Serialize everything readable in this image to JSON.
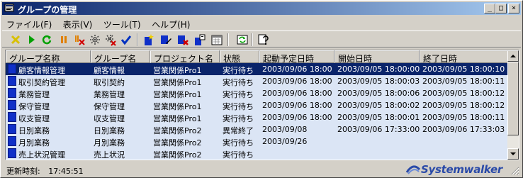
{
  "window": {
    "title": "グループの管理",
    "minimize": "_",
    "maximize": "□",
    "close": "×"
  },
  "menu": [
    {
      "label": "ファイル(F)"
    },
    {
      "label": "表示(V)"
    },
    {
      "label": "ツール(T)"
    },
    {
      "label": "ヘルプ(H)"
    }
  ],
  "toolbar_icons": [
    "cancel-icon",
    "start-icon",
    "restart-icon",
    "pause-icon",
    "stop-icon",
    "disable-icon",
    "enable-icon",
    "confirm-icon",
    "new-group-icon",
    "edit-group-icon",
    "delete-group-icon",
    "properties-icon",
    "calendar-icon",
    "refresh-icon",
    "help-icon"
  ],
  "columns": [
    "グループ名称",
    "グループ名",
    "プロジェクト名",
    "状態",
    "起動予定日時",
    "開始日時",
    "終了日時"
  ],
  "rows": [
    {
      "c0": "顧客情報管理",
      "c1": "顧客情報",
      "c2": "営業関係Pro1",
      "c3": "実行待ち",
      "c4": "2003/09/06 18:00",
      "c5": "2003/09/05 18:00:00",
      "c6": "2003/09/05 18:00:10",
      "selected": true
    },
    {
      "c0": "取引契約管理",
      "c1": "取引契約",
      "c2": "営業関係Pro1",
      "c3": "実行待ち",
      "c4": "2003/09/06 18:00",
      "c5": "2003/09/05 18:00:03",
      "c6": "2003/09/05 18:00:11",
      "selected": false
    },
    {
      "c0": "業務管理",
      "c1": "業務管理",
      "c2": "営業関係Pro1",
      "c3": "実行待ち",
      "c4": "2003/09/06 18:00",
      "c5": "2003/09/05 18:00:06",
      "c6": "2003/09/05 18:00:12",
      "selected": false
    },
    {
      "c0": "保守管理",
      "c1": "保守管理",
      "c2": "営業関係Pro1",
      "c3": "実行待ち",
      "c4": "2003/09/06 18:00",
      "c5": "2003/09/05 18:00:02",
      "c6": "2003/09/05 18:00:12",
      "selected": false
    },
    {
      "c0": "収支管理",
      "c1": "収支管理",
      "c2": "営業関係Pro1",
      "c3": "実行待ち",
      "c4": "2003/09/06 18:00",
      "c5": "2003/09/05 18:00:01",
      "c6": "2003/09/05 18:00:11",
      "selected": false
    },
    {
      "c0": "日別業務",
      "c1": "日別業務",
      "c2": "営業関係Pro2",
      "c3": "異常終了",
      "c4": "2003/09/08",
      "c5": "2003/09/06 17:33:00",
      "c6": "2003/09/06 17:33:03",
      "selected": false
    },
    {
      "c0": "月別業務",
      "c1": "月別業務",
      "c2": "営業関係Pro2",
      "c3": "実行待ち",
      "c4": "2003/09/26",
      "c5": "",
      "c6": "",
      "selected": false
    },
    {
      "c0": "売上状況管理",
      "c1": "売上状況",
      "c2": "営業関係Pro2",
      "c3": "実行待ち",
      "c4": "",
      "c5": "",
      "c6": "",
      "selected": false
    }
  ],
  "status": {
    "label": "更新時刻:",
    "time": "17:45:51"
  },
  "brand": {
    "name": "Systemwalker"
  },
  "colors": {
    "selection": "#0a246a",
    "row_background": "#dbe5f5",
    "title_gradient_start": "#0a246a",
    "title_gradient_end": "#a6caf0"
  }
}
